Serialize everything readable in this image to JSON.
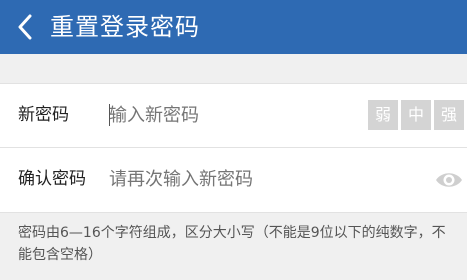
{
  "header": {
    "title": "重置登录密码",
    "background": "#2e6ab3",
    "back_icon": "chevron-left-icon"
  },
  "form": {
    "new_password": {
      "label": "新密码",
      "placeholder": "输入新密码"
    },
    "strength": {
      "weak": "弱",
      "medium": "中",
      "strong": "强"
    },
    "confirm_password": {
      "label": "确认密码",
      "placeholder": "请再次输入新密码",
      "toggle_icon": "eye-icon"
    }
  },
  "hint": "密码由6—16个字符组成，区分大小写（不能是9位以下的纯数字，不能包含空格）"
}
